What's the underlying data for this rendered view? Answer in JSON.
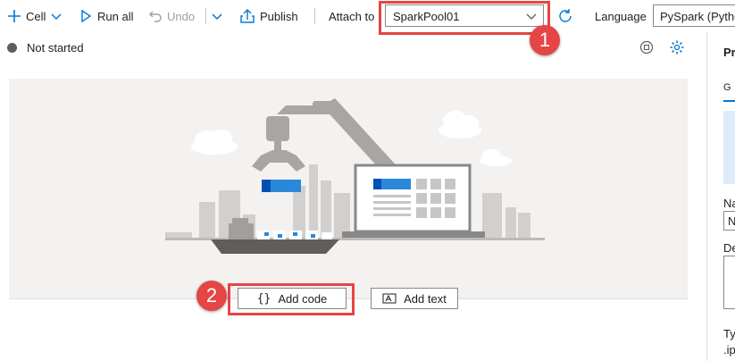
{
  "toolbar": {
    "cell_label": "Cell",
    "run_all_label": "Run all",
    "undo_label": "Undo",
    "publish_label": "Publish",
    "attach_to_label": "Attach to",
    "attach_to_value": "SparkPool01",
    "language_label": "Language",
    "language_value": "PySpark (Pytho"
  },
  "status": {
    "text": "Not started"
  },
  "actions": {
    "add_code_label": "Add code",
    "add_text_label": "Add text"
  },
  "annotations": {
    "badge_1": "1",
    "badge_2": "2",
    "highlight_color": "#e64545"
  },
  "properties_panel": {
    "header": "Pr",
    "tab": "G",
    "name_label": "Na",
    "name_value": "N",
    "description_label": "De",
    "type_label": "Ty",
    "type_value": ".ip"
  },
  "colors": {
    "accent": "#0078d4"
  }
}
